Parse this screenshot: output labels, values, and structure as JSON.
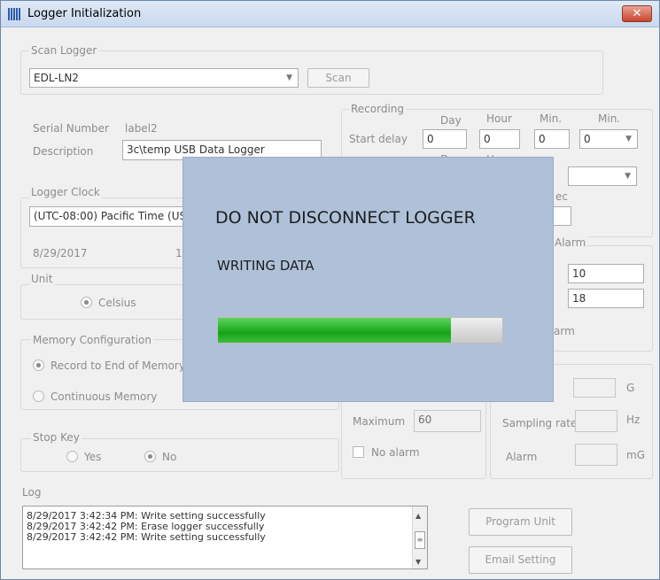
{
  "window": {
    "title": "Logger Initialization",
    "close_glyph": "✕"
  },
  "scan_logger": {
    "legend": "Scan Logger",
    "selected": "EDL-LN2",
    "scan_label": "Scan"
  },
  "device": {
    "serial_label": "Serial Number",
    "serial_value": "label2",
    "description_label": "Description",
    "description_value": "3c\\temp USB Data Logger"
  },
  "logger_clock": {
    "legend": "Logger Clock",
    "timezone": "(UTC-08:00) Pacific Time (US",
    "date": "8/29/2017",
    "time_partial": "1"
  },
  "unit": {
    "legend": "Unit",
    "option": "Celsius"
  },
  "memory": {
    "legend": "Memory Configuration",
    "option1": "Record to End of Memory",
    "option2": "Continuous Memory"
  },
  "stop_key": {
    "legend": "Stop Key",
    "yes": "Yes",
    "no": "No"
  },
  "recording": {
    "legend": "Recording",
    "col_day": "Day",
    "col_hour": "Hour",
    "col_min": "Min.",
    "col_min2": "Min.",
    "start_delay_label": "Start delay",
    "start_day": "0",
    "start_hour": "0",
    "start_min": "0",
    "start_min2": "0",
    "row2_day": "Day",
    "row2_hour": "Hour",
    "sec_fragment": "ec"
  },
  "alarm": {
    "legend_fragment": "Alarm",
    "value1": "10",
    "value2": "18",
    "alarm_fragment": "arm"
  },
  "accel": {
    "maximum_label": "Maximum",
    "maximum_value": "60",
    "no_alarm_label": "No alarm",
    "g_unit": "G",
    "sampling_label": "Sampling rate",
    "hz_unit": "Hz",
    "alarm_label": "Alarm",
    "mg_unit": "mG"
  },
  "log": {
    "legend": "Log",
    "lines": [
      "8/29/2017 3:42:34 PM: Write setting successfully",
      "8/29/2017 3:42:42 PM: Erase logger successfully",
      "8/29/2017 3:42:42 PM: Write setting successfully"
    ]
  },
  "buttons": {
    "program": "Program Unit",
    "email": "Email Setting"
  },
  "overlay": {
    "title": "DO NOT DISCONNECT LOGGER",
    "status": "WRITING DATA",
    "progress": 0.82
  }
}
